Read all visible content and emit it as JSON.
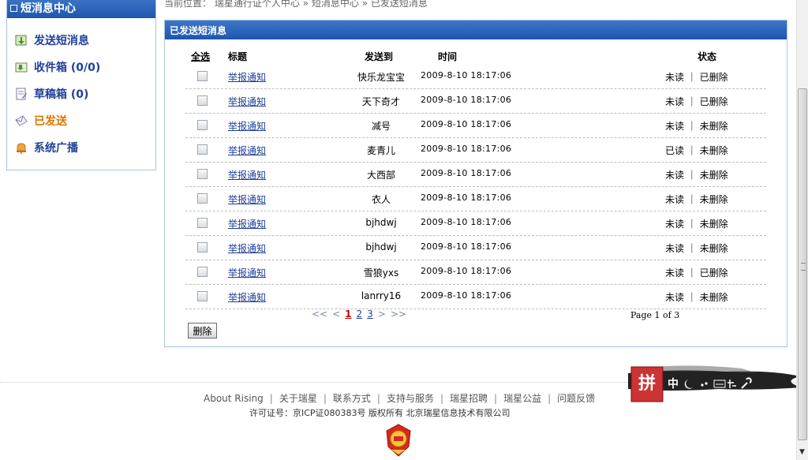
{
  "breadcrumb": {
    "prefix": "当前位置：",
    "items": [
      "瑞星通行证个人中心",
      "短消息中心",
      "已发送短消息"
    ],
    "sep": "»"
  },
  "sidebar": {
    "title": "短消息中心",
    "items": [
      {
        "label": "发送短消息",
        "icon": "send-arrow-icon"
      },
      {
        "label": "收件箱 (0/0)",
        "icon": "inbox-icon"
      },
      {
        "label": "草稿箱 (0)",
        "icon": "draft-icon"
      },
      {
        "label": "已发送",
        "icon": "sent-envelope-icon",
        "active": true
      },
      {
        "label": "系统广播",
        "icon": "broadcast-bell-icon"
      }
    ]
  },
  "main": {
    "title": "已发送短消息",
    "columns": {
      "select_all": "全选",
      "title": "标题",
      "to": "发送到",
      "time": "时间",
      "status": "状态"
    },
    "rows": [
      {
        "title": "举报通知",
        "to": "快乐龙宝宝",
        "time": "2009-8-10  18:17:06",
        "status": "未读 ｜ 已删除"
      },
      {
        "title": "举报通知",
        "to": "天下奇才",
        "time": "2009-8-10  18:17:06",
        "status": "未读 ｜ 已删除"
      },
      {
        "title": "举报通知",
        "to": "减号",
        "time": "2009-8-10  18:17:06",
        "status": "未读 ｜ 未删除"
      },
      {
        "title": "举报通知",
        "to": "麦青儿",
        "time": "2009-8-10  18:17:06",
        "status": "已读 ｜ 未删除"
      },
      {
        "title": "举报通知",
        "to": "大西部",
        "time": "2009-8-10  18:17:06",
        "status": "未读 ｜ 未删除"
      },
      {
        "title": "举报通知",
        "to": "衣人",
        "time": "2009-8-10  18:17:06",
        "status": "未读 ｜ 未删除"
      },
      {
        "title": "举报通知",
        "to": "bjhdwj",
        "time": "2009-8-10  18:17:06",
        "status": "未读 ｜ 未删除"
      },
      {
        "title": "举报通知",
        "to": "bjhdwj",
        "time": "2009-8-10  18:17:06",
        "status": "未读 ｜ 未删除"
      },
      {
        "title": "举报通知",
        "to": "雪狼yxs",
        "time": "2009-8-10  18:17:06",
        "status": "未读 ｜ 已删除"
      },
      {
        "title": "举报通知",
        "to": "lanrry16",
        "time": "2009-8-10  18:17:06",
        "status": "未读 ｜ 未删除"
      }
    ],
    "pager": {
      "first": "<<",
      "prev": "<",
      "pages": [
        "1",
        "2",
        "3"
      ],
      "current": "1",
      "next": ">",
      "last": ">>"
    },
    "page_info": "Page 1 of 3",
    "delete_label": "删除"
  },
  "footer": {
    "links": [
      "About  Rising",
      "关于瑞星",
      "联系方式",
      "支持与服务",
      "瑞星招聘",
      "瑞星公益",
      "问题反馈"
    ],
    "sep": "|",
    "copyright": "许可证号：京ICP证080383号      版权所有    北京瑞星信息技术有限公司"
  },
  "ime_bar": {
    "logo_char": "拼",
    "mode": "中",
    "icons": [
      "moon-icon",
      "punctuation-icon",
      "keyboard-icon",
      "soft-keyboard-icon",
      "wrench-icon"
    ]
  },
  "colors": {
    "header_blue": "#1e56ad",
    "link": "#1f3f9a",
    "active": "#e07400",
    "current_page": "#cc0000"
  }
}
